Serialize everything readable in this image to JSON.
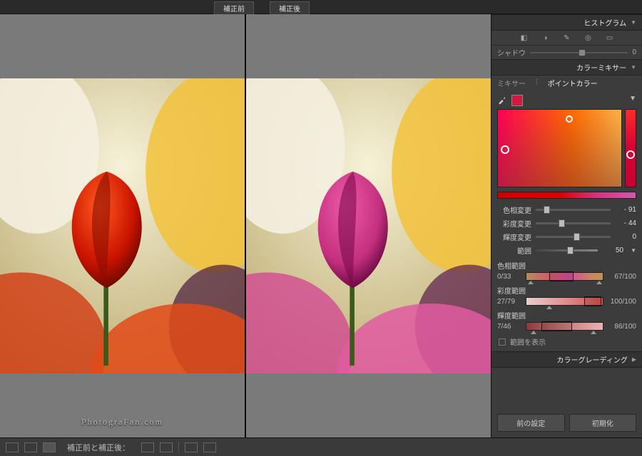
{
  "compare": {
    "before_label": "補正前",
    "after_label": "補正後",
    "status_text": "補正前と補正後："
  },
  "watermark": "PhotograFan.com",
  "panel": {
    "histogram_title": "ヒストグラム",
    "shadow_label": "シャドウ",
    "shadow_value": "0",
    "mixer_title": "カラーミキサー",
    "tabs": {
      "mixer": "ミキサー",
      "point_color": "ポイントカラー"
    },
    "sliders": {
      "hue_shift": {
        "label": "色相変更",
        "value": "- 91"
      },
      "sat_shift": {
        "label": "彩度変更",
        "value": "- 44"
      },
      "lum_shift": {
        "label": "輝度変更",
        "value": "0"
      },
      "range": {
        "label": "範囲",
        "value": "50"
      }
    },
    "ranges": {
      "hue": {
        "label": "色相範囲",
        "left": "0/33",
        "right": "67/100"
      },
      "sat": {
        "label": "彩度範囲",
        "left": "27/79",
        "right": "100/100"
      },
      "lum": {
        "label": "輝度範囲",
        "left": "7/46",
        "right": "86/100"
      }
    },
    "show_range_checkbox": "範囲を表示",
    "color_grading_title": "カラーグレーディング",
    "buttons": {
      "prev": "前の設定",
      "reset": "初期化"
    }
  }
}
